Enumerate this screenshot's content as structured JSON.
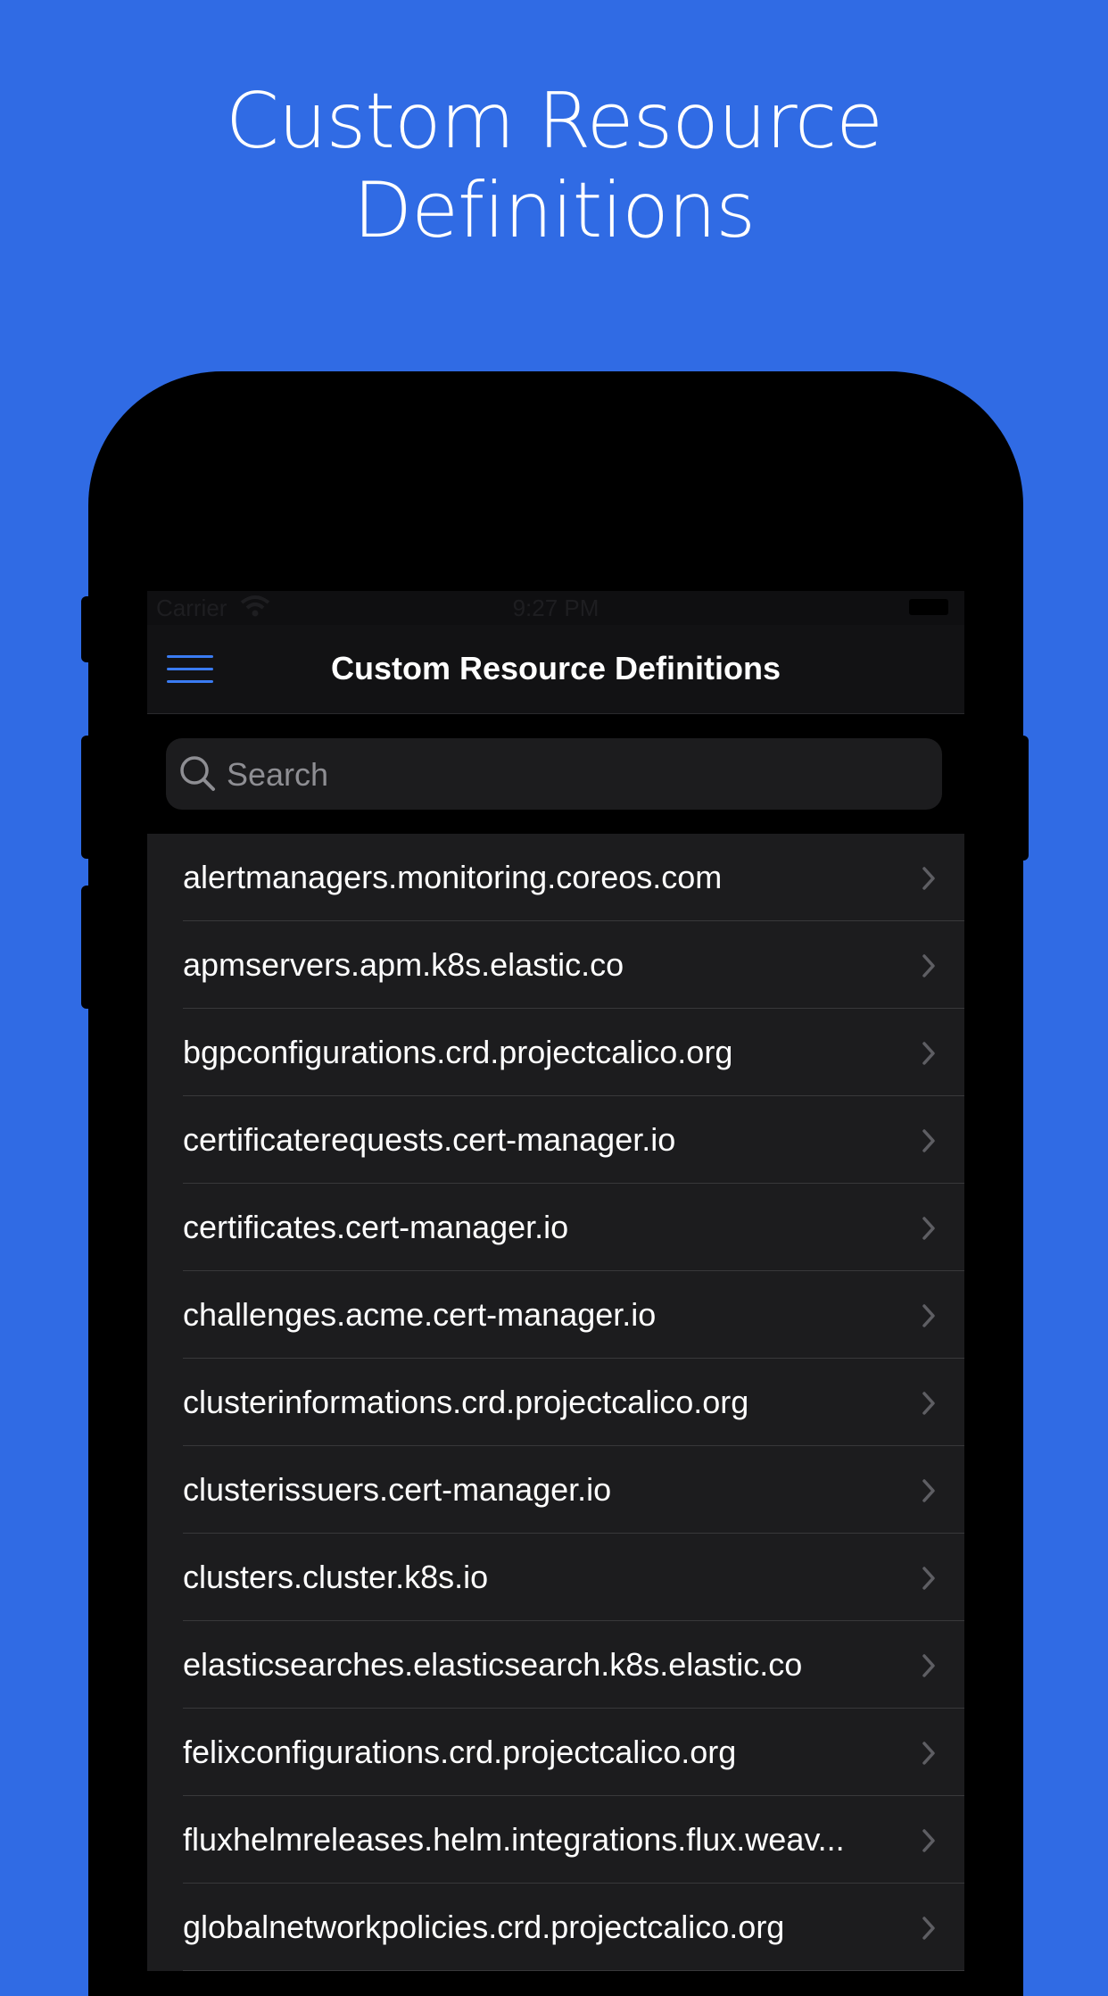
{
  "headline": {
    "line1": "Custom Resource",
    "line2": "Definitions"
  },
  "status_bar": {
    "carrier": "Carrier",
    "time": "9:27 PM"
  },
  "nav": {
    "title": "Custom Resource Definitions",
    "menu_icon": "hamburger-menu-icon"
  },
  "search": {
    "placeholder": "Search",
    "value": ""
  },
  "list": {
    "items": [
      "alertmanagers.monitoring.coreos.com",
      "apmservers.apm.k8s.elastic.co",
      "bgpconfigurations.crd.projectcalico.org",
      "certificaterequests.cert-manager.io",
      "certificates.cert-manager.io",
      "challenges.acme.cert-manager.io",
      "clusterinformations.crd.projectcalico.org",
      "clusterissuers.cert-manager.io",
      "clusters.cluster.k8s.io",
      "elasticsearches.elasticsearch.k8s.elastic.co",
      "felixconfigurations.crd.projectcalico.org",
      "fluxhelmreleases.helm.integrations.flux.weav...",
      "globalnetworkpolicies.crd.projectcalico.org"
    ],
    "row_icon": "chevron-right-icon"
  },
  "colors": {
    "background": "#306BE4",
    "accent": "#3A7BF2",
    "list_bg": "#1C1C1E",
    "nav_bg": "#121214"
  }
}
